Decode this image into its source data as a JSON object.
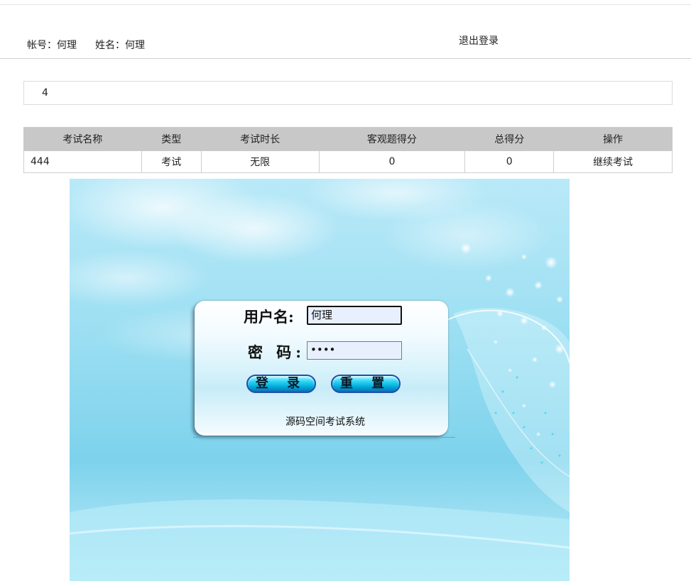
{
  "header": {
    "account_label": "帐号：何理",
    "name_label": "姓名：何理",
    "logout_label": "退出登录"
  },
  "info_box": {
    "text": "4"
  },
  "exam_table": {
    "columns": [
      "考试名称",
      "类型",
      "考试时长",
      "客观题得分",
      "总得分",
      "操作"
    ],
    "rows": [
      [
        "444",
        "考试",
        "无限",
        "0",
        "0",
        "继续考试"
      ]
    ]
  },
  "login_panel": {
    "username_label": "用户名:",
    "username_value": "何理",
    "password_label": "密 码:",
    "password_value": "••••",
    "login_button": "登 录",
    "reset_button": "重 置",
    "system_name": "源码空间考试系统"
  },
  "colors": {
    "table_header_bg": "#c8c8c8",
    "sky_light": "#cdeffb",
    "sky_mid": "#8fd9ef",
    "button_blue": "#00a8d8"
  }
}
